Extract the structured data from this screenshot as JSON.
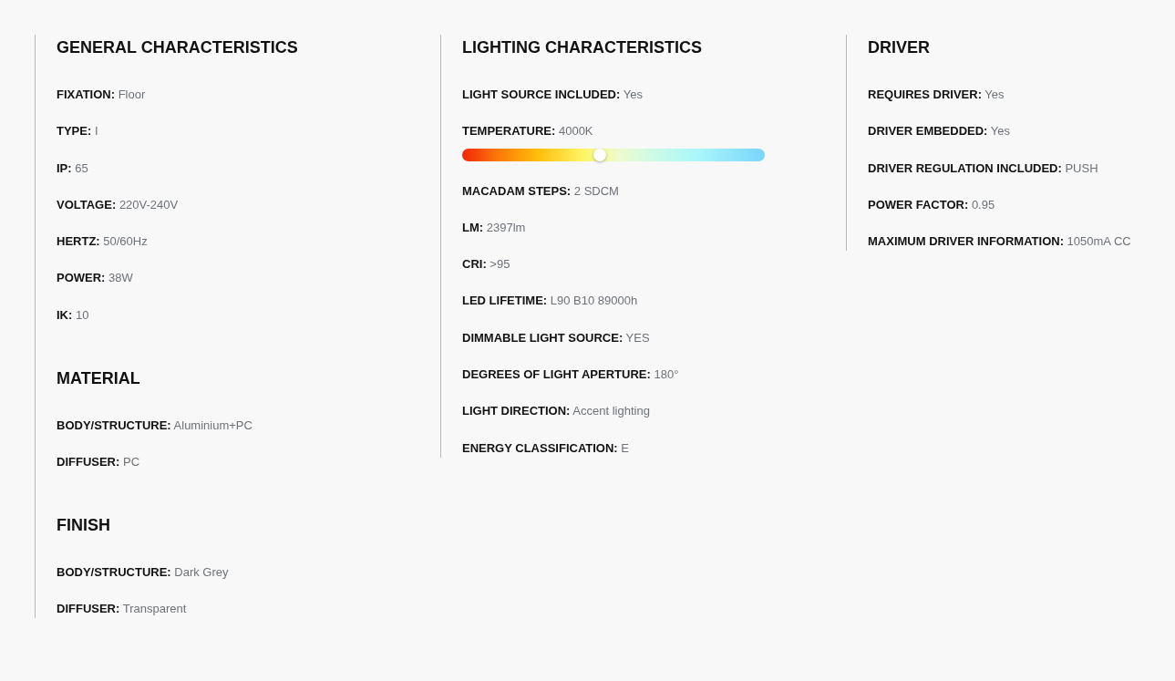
{
  "columns": [
    {
      "sections": [
        {
          "title": "GENERAL CHARACTERISTICS",
          "items": [
            {
              "kind": "text",
              "label": "FIXATION:",
              "value": "Floor"
            },
            {
              "kind": "text",
              "label": "TYPE:",
              "value": "I"
            },
            {
              "kind": "text",
              "label": "IP:",
              "value": "65"
            },
            {
              "kind": "text",
              "label": "VOLTAGE:",
              "value": "220V-240V"
            },
            {
              "kind": "text",
              "label": "HERTZ:",
              "value": "50/60Hz"
            },
            {
              "kind": "text",
              "label": "POWER:",
              "value": "38W"
            },
            {
              "kind": "text",
              "label": "IK:",
              "value": "10"
            }
          ]
        },
        {
          "title": "MATERIAL",
          "items": [
            {
              "kind": "text",
              "label": "BODY/STRUCTURE:",
              "value": "Aluminium+PC"
            },
            {
              "kind": "text",
              "label": "DIFFUSER:",
              "value": "PC"
            }
          ]
        },
        {
          "title": "FINISH",
          "items": [
            {
              "kind": "text",
              "label": "BODY/STRUCTURE:",
              "value": "Dark Grey"
            },
            {
              "kind": "text",
              "label": "DIFFUSER:",
              "value": "Transparent"
            }
          ]
        }
      ]
    },
    {
      "sections": [
        {
          "title": "LIGHTING CHARACTERISTICS",
          "items": [
            {
              "kind": "text",
              "label": "LIGHT SOURCE INCLUDED:",
              "value": "Yes"
            },
            {
              "kind": "gradient",
              "label": "TEMPERATURE:",
              "value": "4000K",
              "level": 0.455
            },
            {
              "kind": "text",
              "label": "MACADAM STEPS:",
              "value": "2 SDCM"
            },
            {
              "kind": "text",
              "label": "LM:",
              "value": "2397lm"
            },
            {
              "kind": "text",
              "label": "CRI:",
              "value": ">95"
            },
            {
              "kind": "text",
              "label": "LED LIFETIME:",
              "value": "L90 B10 89000h"
            },
            {
              "kind": "text",
              "label": "DIMMABLE LIGHT SOURCE:",
              "value": "YES"
            },
            {
              "kind": "text",
              "label": "DEGREES OF LIGHT APERTURE:",
              "value": "180°"
            },
            {
              "kind": "text",
              "label": "LIGHT DIRECTION:",
              "value": "Accent lighting"
            },
            {
              "kind": "text",
              "label": "ENERGY CLASSIFICATION:",
              "value": "E"
            }
          ]
        }
      ]
    },
    {
      "sections": [
        {
          "title": "DRIVER",
          "items": [
            {
              "kind": "text",
              "label": "REQUIRES DRIVER:",
              "value": "Yes"
            },
            {
              "kind": "text",
              "label": "DRIVER EMBEDDED:",
              "value": "Yes"
            },
            {
              "kind": "text",
              "label": "DRIVER REGULATION INCLUDED:",
              "value": "PUSH"
            },
            {
              "kind": "text",
              "label": "POWER FACTOR:",
              "value": "0.95"
            },
            {
              "kind": "text",
              "label": "MAXIMUM DRIVER INFORMATION:",
              "value": "1050mA CC"
            }
          ]
        }
      ]
    }
  ]
}
